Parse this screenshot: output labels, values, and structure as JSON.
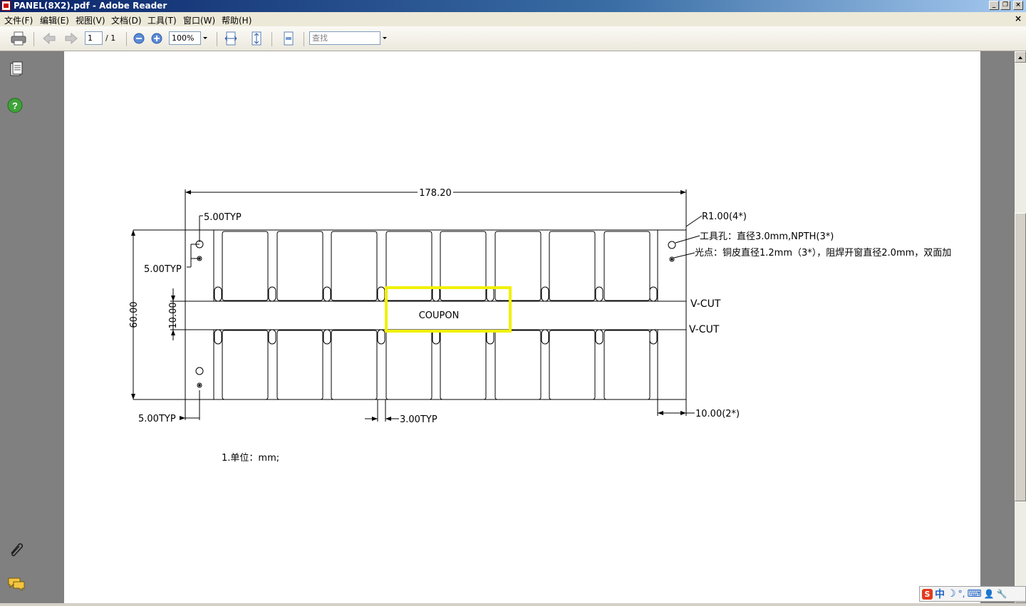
{
  "window": {
    "title": "PANEL(8X2).pdf - Adobe Reader",
    "min_label": "_",
    "max_label": "❐",
    "close_label": "×"
  },
  "menu": {
    "items": [
      {
        "label": "文件(F)"
      },
      {
        "label": "编辑(E)"
      },
      {
        "label": "视图(V)"
      },
      {
        "label": "文档(D)"
      },
      {
        "label": "工具(T)"
      },
      {
        "label": "窗口(W)"
      },
      {
        "label": "帮助(H)"
      }
    ],
    "doc_close": "×"
  },
  "toolbar": {
    "page_current": "1",
    "page_total": "/ 1",
    "zoom": "100%",
    "search_placeholder": "查找"
  },
  "icons": {
    "print": "printer-icon",
    "prev": "arrow-left-icon",
    "next": "arrow-right-icon",
    "zoom_out": "zoom-out-icon",
    "zoom_in": "zoom-in-icon",
    "fit_width": "fit-width-icon",
    "fit_page": "fit-page-icon",
    "single_page": "single-page-icon",
    "pages_panel": "pages-icon",
    "help": "help-icon",
    "attach": "paperclip-icon",
    "comments": "comments-icon"
  },
  "drawing": {
    "dim_width": "178.20",
    "dim_left_edge": "5.00TYP",
    "dim_left_hole": "5.00TYP",
    "dim_bottom": "5.00TYP",
    "dim_height": "60.00",
    "dim_rail": "10.00",
    "dim_gap": "3.00TYP",
    "dim_right_rail": "10.00(2*)",
    "radius": "R1.00(4*)",
    "tool_hole": "工具孔：直径3.0mm,NPTH(3*)",
    "fiducial": "光点：铜皮直径1.2mm（3*），阻焊开窗直径2.0mm，双面加",
    "vcut_top": "V-CUT",
    "vcut_bottom": "V-CUT",
    "coupon": "COUPON",
    "note": "1.单位：mm;"
  },
  "highlight_color": "#f0f000",
  "ime": {
    "chinese": "中",
    "moon": "☽",
    "degree": "°,",
    "keyboard": "⌨",
    "user": "👤",
    "tool": "🔧"
  }
}
